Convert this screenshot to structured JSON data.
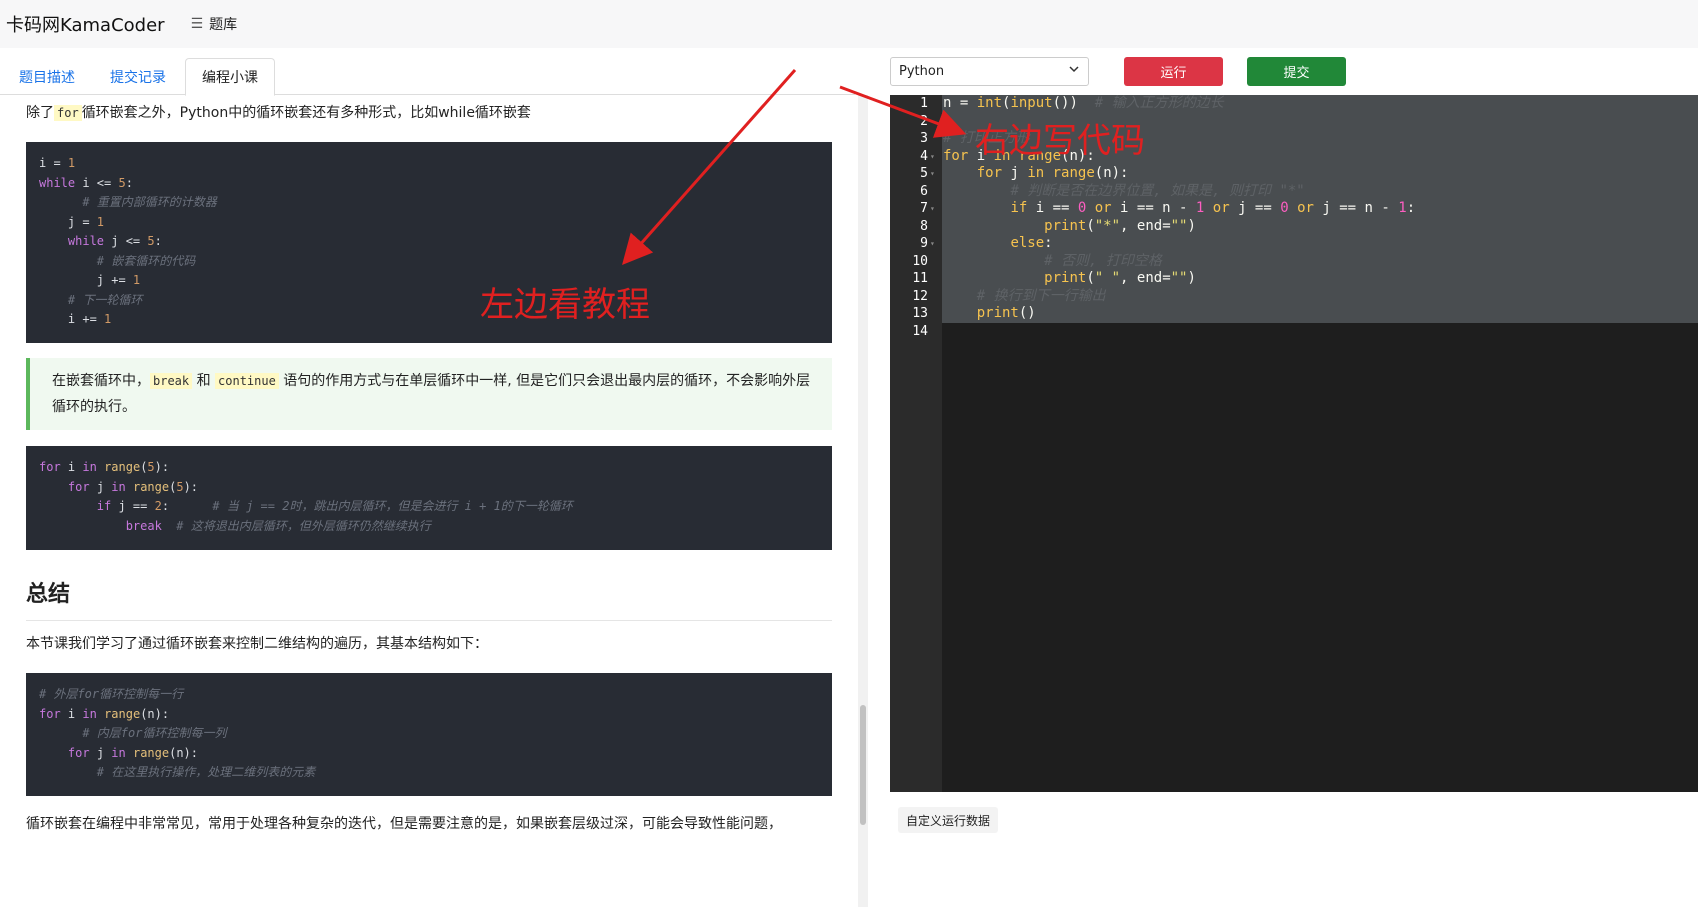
{
  "header": {
    "brand": "卡码网KamaCoder",
    "nav_item": "题库"
  },
  "tabs": [
    {
      "label": "题目描述"
    },
    {
      "label": "提交记录"
    },
    {
      "label": "编程小课"
    }
  ],
  "lesson": {
    "intro_before": "除了",
    "intro_code": "for",
    "intro_after": "循环嵌套之外，Python中的循环嵌套还有多种形式，比如while循环嵌套",
    "quote_before": "在嵌套循环中，",
    "quote_code1": "break",
    "quote_mid": " 和 ",
    "quote_code2": "continue",
    "quote_after": " 语句的作用方式与在单层循环中一样, 但是它们只会退出最内层的循环，不会影响外层循环的执行。",
    "summary_title": "总结",
    "summary_text": "本节课我们学习了通过循环嵌套来控制二维结构的遍历，其基本结构如下：",
    "footer_text": "循环嵌套在编程中非常常见，常用于处理各种复杂的迭代，但是需要注意的是，如果嵌套层级过深，可能会导致性能问题，"
  },
  "annotations": {
    "left": "左边看教程",
    "right": "右边写代码"
  },
  "toolbar": {
    "language": "Python",
    "run_label": "运行",
    "submit_label": "提交"
  },
  "editor": {
    "line_numbers": [
      "1",
      "2",
      "3",
      "4",
      "5",
      "6",
      "7",
      "8",
      "9",
      "10",
      "11",
      "12",
      "13",
      "14"
    ]
  },
  "custom_run_label": "自定义运行数据",
  "colors": {
    "run": "#dc3545",
    "submit": "#218838",
    "annotation": "#e02020",
    "link": "#1a73e8"
  }
}
